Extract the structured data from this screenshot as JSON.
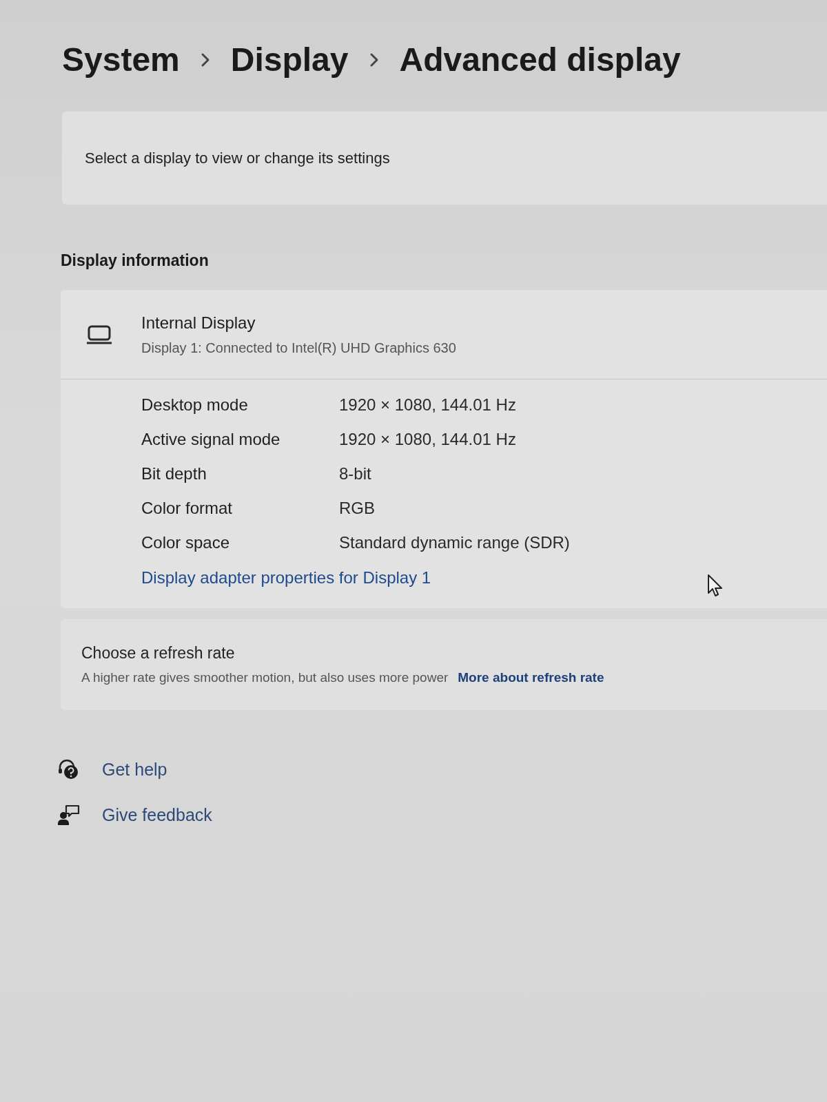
{
  "breadcrumb": [
    {
      "label": "System"
    },
    {
      "label": "Display"
    },
    {
      "label": "Advanced display"
    }
  ],
  "display_selector": {
    "label": "Select a display to view or change its settings"
  },
  "display_information": {
    "heading": "Display information",
    "display": {
      "name": "Internal Display",
      "description": "Display 1: Connected to Intel(R) UHD Graphics 630"
    },
    "properties": [
      {
        "label": "Desktop mode",
        "value": "1920 × 1080, 144.01 Hz"
      },
      {
        "label": "Active signal mode",
        "value": "1920 × 1080, 144.01 Hz"
      },
      {
        "label": "Bit depth",
        "value": "8-bit"
      },
      {
        "label": "Color format",
        "value": "RGB"
      },
      {
        "label": "Color space",
        "value": "Standard dynamic range (SDR)"
      }
    ],
    "link": "Display adapter properties for Display 1"
  },
  "refresh_rate": {
    "title": "Choose a refresh rate",
    "description": "A higher rate gives smoother motion, but also uses more power",
    "link": "More about refresh rate"
  },
  "help_links": [
    {
      "kind": "help",
      "label": "Get help"
    },
    {
      "kind": "feedback",
      "label": "Give feedback"
    }
  ]
}
